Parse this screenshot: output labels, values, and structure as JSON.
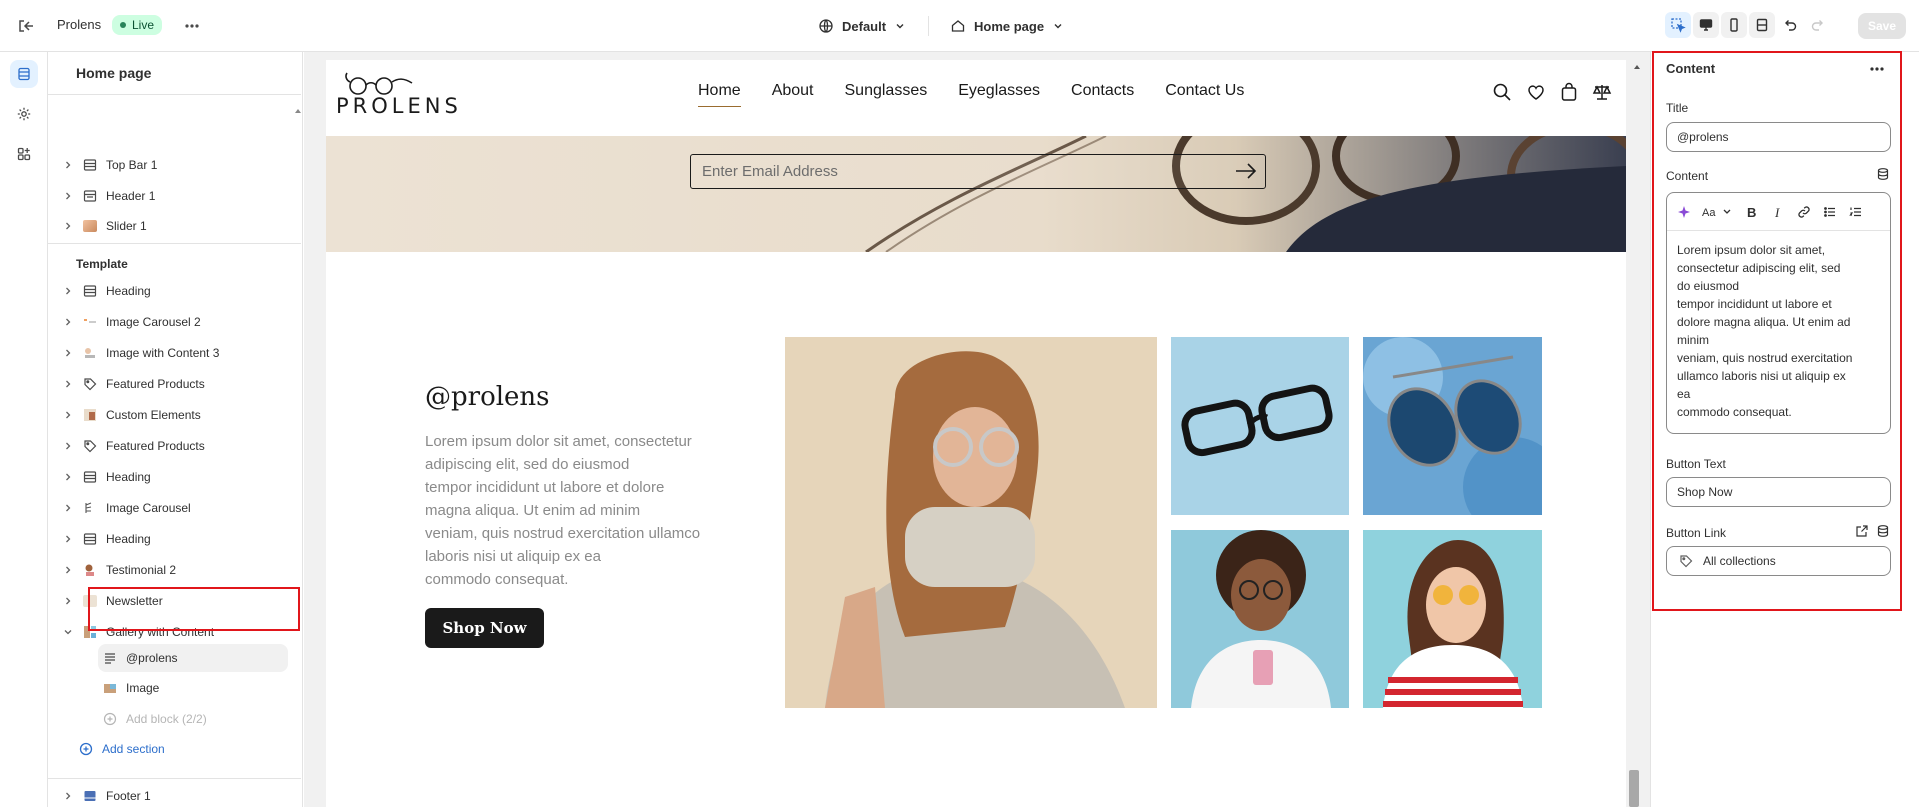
{
  "topbar": {
    "store_name": "Prolens",
    "status": "Live",
    "theme": "Default",
    "page": "Home page",
    "save_label": "Save"
  },
  "tree": {
    "title": "Home page",
    "header_sections": [
      {
        "label": "Top Bar 1",
        "icon": "section-icon"
      },
      {
        "label": "Header 1",
        "icon": "header-icon"
      },
      {
        "label": "Slider 1",
        "icon": "image-thumb"
      }
    ],
    "template_label": "Template",
    "template_sections": [
      {
        "label": "Heading",
        "icon": "section-icon"
      },
      {
        "label": "Image Carousel 2",
        "icon": "image-thumb"
      },
      {
        "label": "Image with Content 3",
        "icon": "image-thumb"
      },
      {
        "label": "Featured Products",
        "icon": "tag-icon"
      },
      {
        "label": "Custom Elements",
        "icon": "image-thumb"
      },
      {
        "label": "Featured Products",
        "icon": "tag-icon"
      },
      {
        "label": "Heading",
        "icon": "section-icon"
      },
      {
        "label": "Image Carousel",
        "icon": "image-thumb"
      },
      {
        "label": "Heading",
        "icon": "section-icon"
      },
      {
        "label": "Testimonial 2",
        "icon": "image-thumb"
      },
      {
        "label": "Newsletter",
        "icon": "image-thumb"
      },
      {
        "label": "Gallery with Content",
        "icon": "image-thumb"
      }
    ],
    "gallery_blocks": [
      {
        "label": "@prolens",
        "icon": "text-icon"
      },
      {
        "label": "Image",
        "icon": "image-thumb"
      }
    ],
    "add_block": "Add block (2/2)",
    "add_section": "Add section",
    "footer_sections": [
      {
        "label": "Footer 1",
        "icon": "footer-icon"
      }
    ]
  },
  "preview": {
    "logo_text": "PROLENS",
    "nav": [
      "Home",
      "About",
      "Sunglasses",
      "Eyeglasses",
      "Contacts",
      "Contact Us"
    ],
    "email_placeholder": "Enter Email Address",
    "gallery_title": "@prolens",
    "gallery_body": "Lorem ipsum dolor sit amet, consectetur\nadipiscing elit, sed do eiusmod\ntempor incididunt ut labore et dolore\nmagna aliqua. Ut enim ad minim\nveniam, quis nostrud exercitation ullamco\nlaboris nisi ut aliquip ex ea\ncommodo consequat.",
    "gallery_button": "Shop Now"
  },
  "panel": {
    "title": "Content",
    "title_label": "Title",
    "title_value": "@prolens",
    "content_label": "Content",
    "content_value": "Lorem ipsum dolor sit amet,\nconsectetur adipiscing elit, sed\ndo eiusmod\ntempor incididunt ut labore et\ndolore magna aliqua. Ut enim ad\nminim\nveniam, quis nostrud exercitation\nullamco laboris nisi ut aliquip ex\nea\ncommodo consequat.",
    "button_text_label": "Button Text",
    "button_text_value": "Shop Now",
    "button_link_label": "Button Link",
    "button_link_value": "All collections"
  },
  "colors": {
    "accent": "#2c6ecb",
    "highlight": "#e1161b",
    "live_badge": "#cdfee1"
  }
}
